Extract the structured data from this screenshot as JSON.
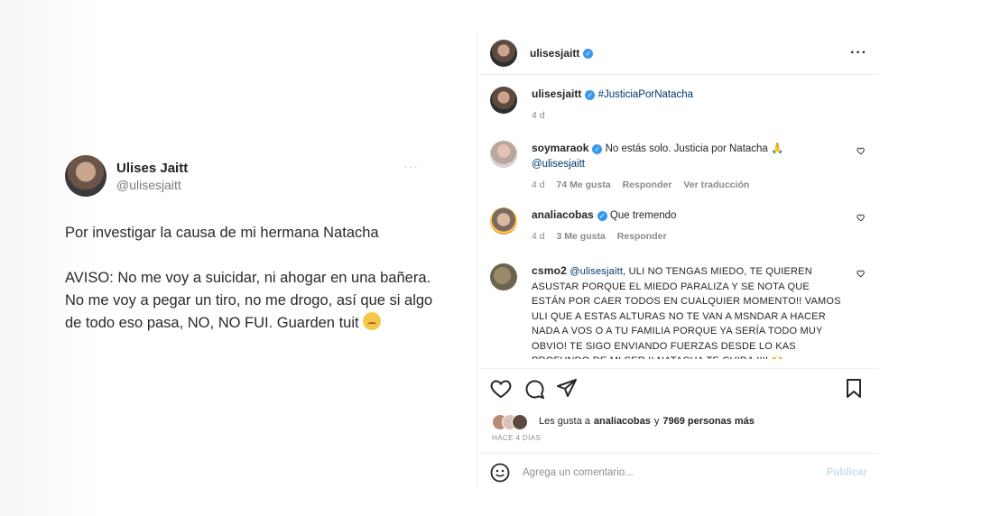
{
  "tweet": {
    "name": "Ulises Jaitt",
    "handle": "@ulisesjaitt",
    "more": "···",
    "line1": "Por investigar la causa de mi hermana Natacha",
    "line2": "AVISO: No me voy a suicidar, ni ahogar en una bañera. No me voy a pegar un tiro, no me drogo, así que si algo de todo eso pasa, NO, NO FUI. Guarden tuit"
  },
  "instagram": {
    "header": {
      "username": "ulisesjaitt",
      "more": "···"
    },
    "caption": {
      "username": "ulisesjaitt",
      "hashtag": "#JusticiaPorNatacha",
      "time": "4 d"
    },
    "comments": [
      {
        "username": "soymaraok",
        "text": "No estás solo. Justicia por Natacha",
        "mention": "@ulisesjaitt",
        "time": "4 d",
        "likes": "74 Me gusta",
        "reply": "Responder",
        "translate": "Ver traducción"
      },
      {
        "username": "analiacobas",
        "text": "Que tremendo",
        "time": "4 d",
        "likes": "3 Me gusta",
        "reply": "Responder"
      },
      {
        "username": "csmo2",
        "mention": "@ulisesjaitt",
        "text": ", ULI NO TENGAS MIEDO, TE QUIEREN ASUSTAR PORQUE EL MIEDO PARALIZA Y SE NOTA QUE ESTÁN POR CAER TODOS EN CUALQUIER MOMENTO!! VAMOS ULI QUE A ESTAS ALTURAS NO TE VAN A MSNDAR A HACER NADA A VOS O A TU FAMILIA PORQUE YA SERÍA TODO MUY OBVIO! TE SIGO ENVIANDO FUERZAS DESDE LO KAS PROFUNDO DE MI SER !! NATACHA TE CUIDA !!!!"
      }
    ],
    "likes": {
      "prefix": "Les gusta a",
      "user": "analiacobas",
      "connector": "y",
      "others": "7969 personas más"
    },
    "posted": "HACE 4 DÍAS",
    "add_comment": {
      "placeholder": "Agrega un comentario...",
      "publish": "Publicar"
    }
  },
  "colors": {
    "verified": "#3897f0",
    "link": "#00376b",
    "muted": "#8e8e8e"
  }
}
